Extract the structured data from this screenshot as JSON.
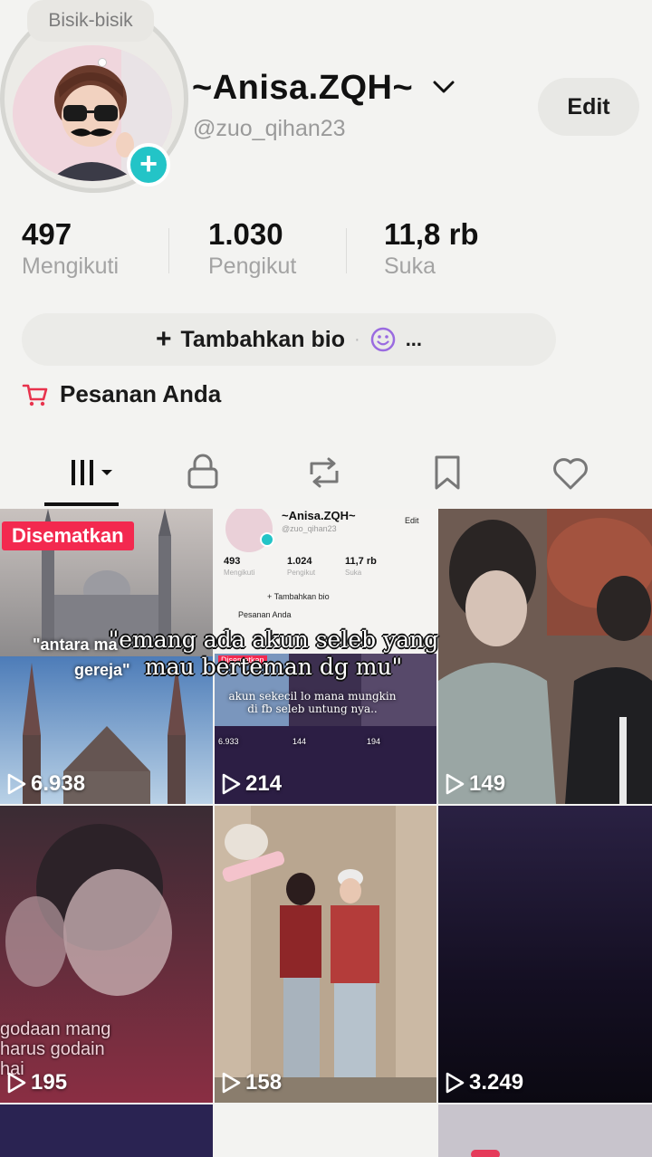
{
  "profile": {
    "whisper_label": "Bisik-bisik",
    "display_name": "~Anisa.ZQH~",
    "username": "@zuo_qihan23",
    "edit_label": "Edit"
  },
  "stats": [
    {
      "value": "497",
      "label": "Mengikuti"
    },
    {
      "value": "1.030",
      "label": "Pengikut"
    },
    {
      "value": "11,8 rb",
      "label": "Suka"
    }
  ],
  "bio": {
    "add_label": "Tambahkan bio",
    "separator": "·",
    "more": "..."
  },
  "orders": {
    "label": "Pesanan Anda"
  },
  "tabs": [
    "videos-icon",
    "lock-icon",
    "repost-icon",
    "bookmark-icon",
    "heart-icon"
  ],
  "grid": {
    "overlay_caption": "\"emang ada akun seleb yang mau berteman dg mu\"",
    "videos": [
      {
        "views": "6.938",
        "pinned": "Disematkan",
        "caption_a": "\"antara ma",
        "caption_b": "gereja\""
      },
      {
        "views": "214",
        "mini_name": "~Anisa.ZQH~",
        "mini_user": "@zuo_qihan23",
        "mini_edit": "Edit",
        "mini_stats": [
          "493",
          "1.024",
          "11,7 rb"
        ],
        "mini_labels": [
          "Mengikuti",
          "Pengikut",
          "Suka"
        ],
        "mini_bio": "+ Tambahkan bio",
        "mini_orders": "Pesanan Anda",
        "mini_pinned": "Disematkan",
        "mini_caption": "akun sekecil lo mana mungkin di fb seleb untung nya..",
        "mini_views": [
          "6.933",
          "144",
          "194"
        ]
      },
      {
        "views": "149"
      },
      {
        "views": "195",
        "caption": "godaan mang harus godain hai"
      },
      {
        "views": "158"
      },
      {
        "views": "3.249"
      }
    ]
  },
  "colors": {
    "background": "#f3f3f1",
    "accent_teal": "#23c4c7",
    "pinned_red": "#f3294f",
    "cart_red": "#e8334d",
    "emoji_purple": "#9a6be0"
  }
}
